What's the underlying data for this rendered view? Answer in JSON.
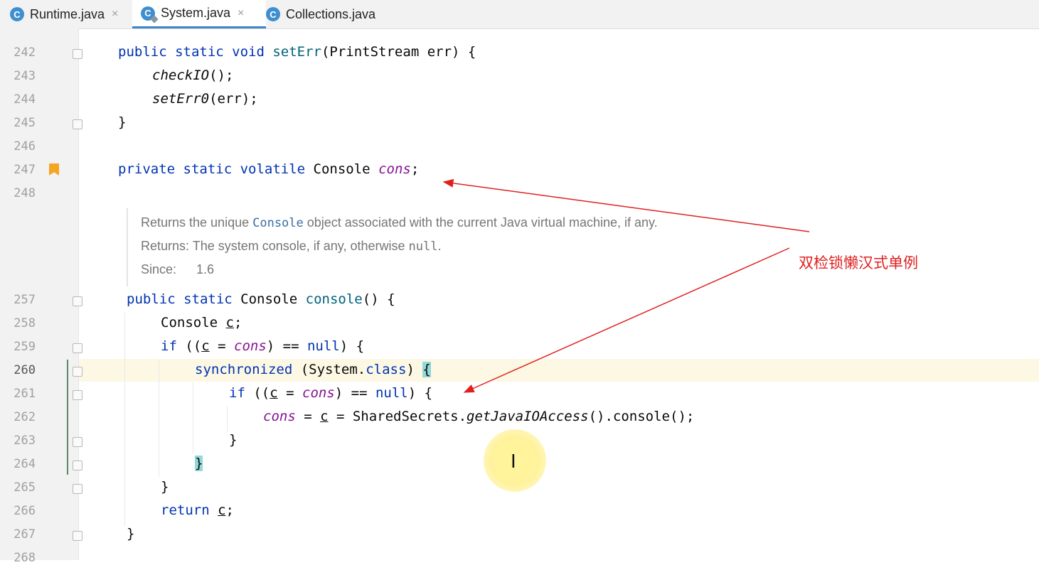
{
  "tabs": [
    {
      "label": "Runtime.java",
      "icon": "java-class-icon",
      "close": "×"
    },
    {
      "label": "System.java",
      "icon": "java-class-icon",
      "close": "×"
    },
    {
      "label": "Collections.java",
      "icon": "java-class-icon",
      "close": ""
    }
  ],
  "tab_icon_letter": "C",
  "line_numbers": [
    "242",
    "243",
    "244",
    "245",
    "246",
    "247",
    "248",
    "257",
    "258",
    "259",
    "260",
    "261",
    "262",
    "263",
    "264",
    "265",
    "266",
    "267",
    "268"
  ],
  "code": {
    "l242": {
      "t1": "public static void ",
      "t2": "setErr",
      "t3": "(PrintStream err) {"
    },
    "l243": {
      "t1": "checkIO",
      "t2": "();"
    },
    "l244": {
      "t1": "setErr0",
      "t2": "(err);"
    },
    "l245": {
      "t1": "}"
    },
    "l247": {
      "t1": "private static volatile ",
      "t2": "Console ",
      "t3": "cons",
      ";": ";"
    },
    "l257": {
      "t1": "public static ",
      "t2": "Console ",
      "t3": "console",
      "t4": "() {"
    },
    "l258": {
      "t1": "Console ",
      "t2": "c",
      ";": ";"
    },
    "l259": {
      "t1": "if",
      "t2": " ((",
      "t3": "c",
      "t4": " = ",
      "t5": "cons",
      "t6": ") == ",
      "t7": "null",
      "t8": ") {"
    },
    "l260": {
      "t1": "synchronized",
      "t2": " (System.",
      "t3": "class",
      "t4": ") ",
      "t5": "{"
    },
    "l261": {
      "t1": "if",
      "t2": " ((",
      "t3": "c",
      "t4": " = ",
      "t5": "cons",
      "t6": ") == ",
      "t7": "null",
      "t8": ") {"
    },
    "l262": {
      "t1": "cons",
      "t2": " = ",
      "t3": "c",
      "t4": " = SharedSecrets.",
      "t5": "getJavaIOAccess",
      "t6": "().console();"
    },
    "l263": {
      "t1": "}"
    },
    "l264": {
      "t1": "}"
    },
    "l265": {
      "t1": "}"
    },
    "l266": {
      "t1": "return ",
      "t2": "c",
      ";": ";"
    },
    "l267": {
      "t1": "}"
    }
  },
  "doc": {
    "line1_a": "Returns the unique ",
    "line1_code": "Console",
    "line1_b": " object associated with the current Java virtual machine, if any.",
    "line2_a": "Returns: The system console, if any, otherwise ",
    "line2_code": "null",
    "line2_b": ".",
    "line3_label": "Since:",
    "line3_value": "1.6"
  },
  "annotation": "双检锁懒汉式单例",
  "colors": {
    "annotation": "#e02020",
    "keyword": "#0033b3",
    "field": "#871094",
    "method": "#00627a",
    "bookmark": "#f4a623"
  }
}
